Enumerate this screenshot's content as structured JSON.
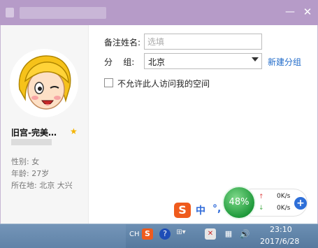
{
  "window": {
    "min_icon": "minimize-icon",
    "min_glyph": "—",
    "close_icon": "close-icon",
    "close_glyph": "✕",
    "title_color": "#b69bc8"
  },
  "profile": {
    "nickname": "旧宫-完美…",
    "star_glyph": "★",
    "gender": "性别: 女",
    "age": "年龄: 27岁",
    "location": "所在地: 北京  大兴"
  },
  "form": {
    "remark_label": "备注姓名:",
    "remark_placeholder": "选填",
    "group_label": "分    组:",
    "group_value": "北京",
    "new_group_link": "新建分组",
    "deny_label": "不允许此人访问我的空间",
    "link_color": "#1f6ac9"
  },
  "ime": {
    "logo": "S",
    "mode": "中",
    "punct": "°,"
  },
  "network": {
    "usage": "48%",
    "up_glyph": "↑",
    "down_glyph": "↓",
    "up_speed": "0K/s",
    "down_speed": "0K/s",
    "add_glyph": "+"
  },
  "taskbar": {
    "lang": "CH",
    "sogou": "S",
    "help": "?",
    "misc": "⊞▾",
    "flag": "✕",
    "net": "▦",
    "volume": "🔊",
    "time": "23:10",
    "date": "2017/6/28"
  }
}
